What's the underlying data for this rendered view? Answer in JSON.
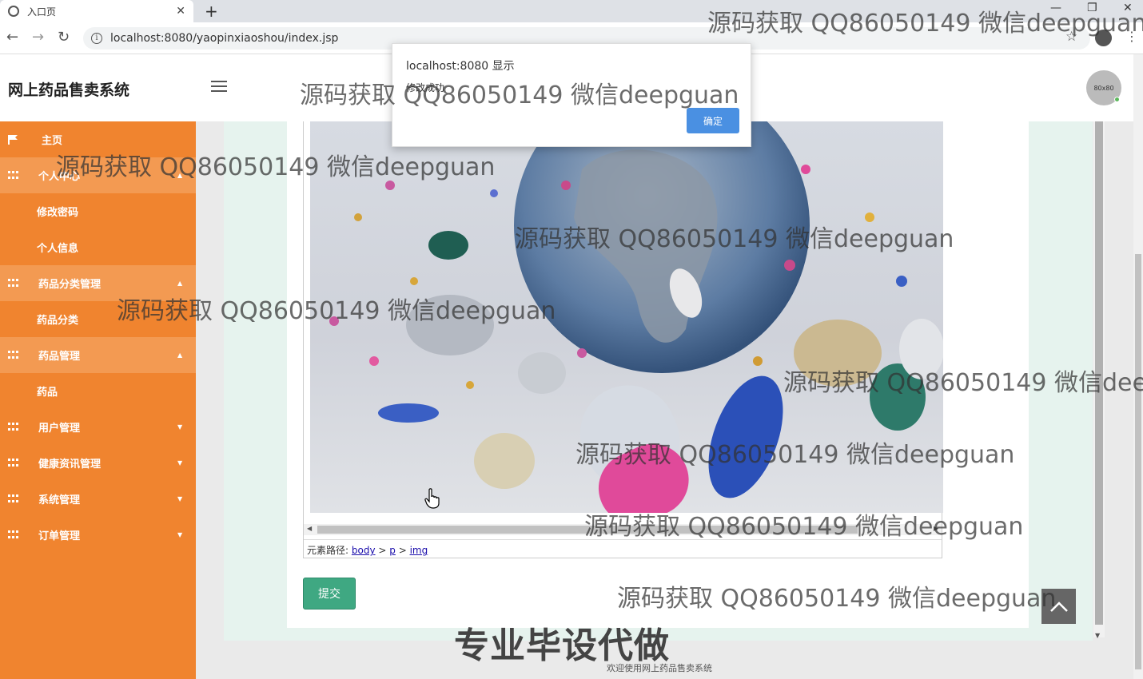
{
  "browser": {
    "tab_title": "入口页",
    "url": "localhost:8080/yaopinxiaoshou/index.jsp"
  },
  "app": {
    "title": "网上药品售卖系统",
    "avatar_label": "80x80",
    "footer": "欢迎使用网上药品售卖系统"
  },
  "sidebar": {
    "items": [
      {
        "label": "主页"
      },
      {
        "label": "个人中心"
      },
      {
        "label": "修改密码"
      },
      {
        "label": "个人信息"
      },
      {
        "label": "药品分类管理"
      },
      {
        "label": "药品分类"
      },
      {
        "label": "药品管理"
      },
      {
        "label": "药品"
      },
      {
        "label": "用户管理"
      },
      {
        "label": "健康资讯管理"
      },
      {
        "label": "系统管理"
      },
      {
        "label": "订单管理"
      }
    ]
  },
  "editor": {
    "path_label": "元素路径:",
    "path": [
      "body",
      "p",
      "img"
    ],
    "submit_label": "提交"
  },
  "alert": {
    "title": "localhost:8080 显示",
    "message": "修改成功",
    "ok_label": "确定"
  },
  "overlay": {
    "watermark": "源码获取 QQ86050149 微信deepguan",
    "promo": "专业毕设代做"
  }
}
